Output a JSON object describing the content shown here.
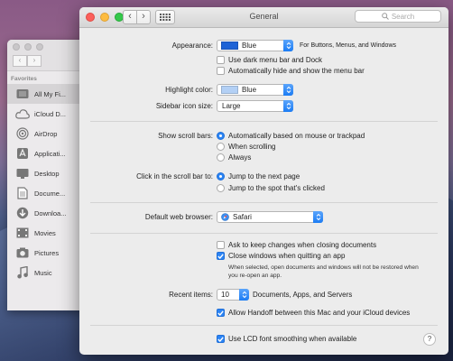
{
  "window": {
    "title": "General",
    "search_placeholder": "Search"
  },
  "finder": {
    "favorites_heading": "Favorites",
    "items": [
      {
        "label": "All My Fi...",
        "icon": "all-my-files-icon"
      },
      {
        "label": "iCloud D...",
        "icon": "icloud-icon"
      },
      {
        "label": "AirDrop",
        "icon": "airdrop-icon"
      },
      {
        "label": "Applicati...",
        "icon": "applications-icon"
      },
      {
        "label": "Desktop",
        "icon": "desktop-icon"
      },
      {
        "label": "Docume...",
        "icon": "documents-icon"
      },
      {
        "label": "Downloa...",
        "icon": "downloads-icon"
      },
      {
        "label": "Movies",
        "icon": "movies-icon"
      },
      {
        "label": "Pictures",
        "icon": "pictures-icon"
      },
      {
        "label": "Music",
        "icon": "music-icon"
      }
    ]
  },
  "appearance": {
    "label": "Appearance:",
    "value": "Blue",
    "swatch_color": "#1e63d6",
    "suffix": "For Buttons, Menus, and Windows",
    "dark_menu": "Use dark menu bar and Dock",
    "auto_hide": "Automatically hide and show the menu bar"
  },
  "highlight": {
    "label": "Highlight color:",
    "value": "Blue",
    "swatch_color": "#b3d0f5"
  },
  "sidebar_icon": {
    "label": "Sidebar icon size:",
    "value": "Large"
  },
  "scroll_bars": {
    "label": "Show scroll bars:",
    "options": [
      "Automatically based on mouse or trackpad",
      "When scrolling",
      "Always"
    ]
  },
  "scroll_click": {
    "label": "Click in the scroll bar to:",
    "options": [
      "Jump to the next page",
      "Jump to the spot that's clicked"
    ]
  },
  "browser": {
    "label": "Default web browser:",
    "value": "Safari"
  },
  "documents": {
    "ask_keep": "Ask to keep changes when closing documents",
    "close_windows": "Close windows when quitting an app",
    "note": "When selected, open documents and windows will not be restored when you re-open an app."
  },
  "recent": {
    "label": "Recent items:",
    "value": "10",
    "suffix": "Documents, Apps, and Servers"
  },
  "handoff": "Allow Handoff between this Mac and your iCloud devices",
  "lcd": "Use LCD font smoothing when available",
  "help": "?"
}
